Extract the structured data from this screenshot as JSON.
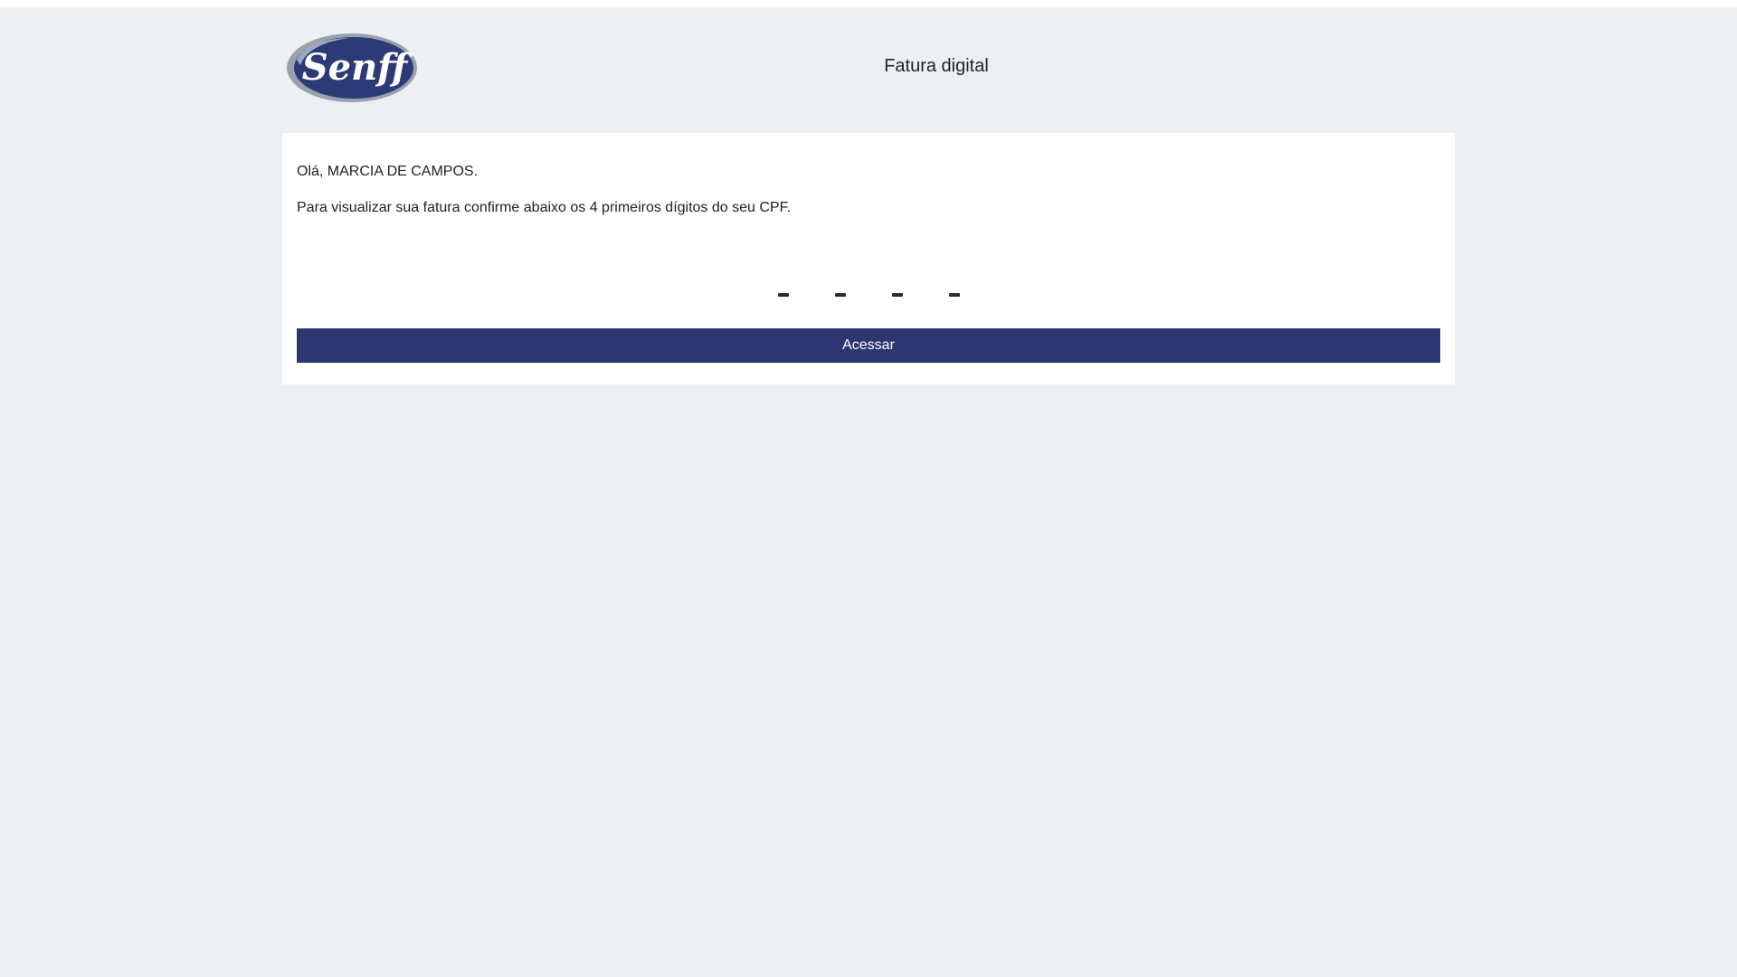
{
  "header": {
    "logo_text": "Senff",
    "title": "Fatura digital"
  },
  "card": {
    "greeting": "Olá, MARCIA DE CAMPOS.",
    "instruction": "Para visualizar sua fatura confirme abaixo os 4 primeiros dígitos do seu CPF.",
    "pin_digits": [
      "",
      "",
      "",
      ""
    ],
    "access_button_label": "Acessar"
  },
  "colors": {
    "background": "#edf0f3",
    "card": "#ffffff",
    "primary": "#2d3670",
    "logo_blue": "#2c3a78",
    "logo_gray": "#9aa1ad"
  }
}
